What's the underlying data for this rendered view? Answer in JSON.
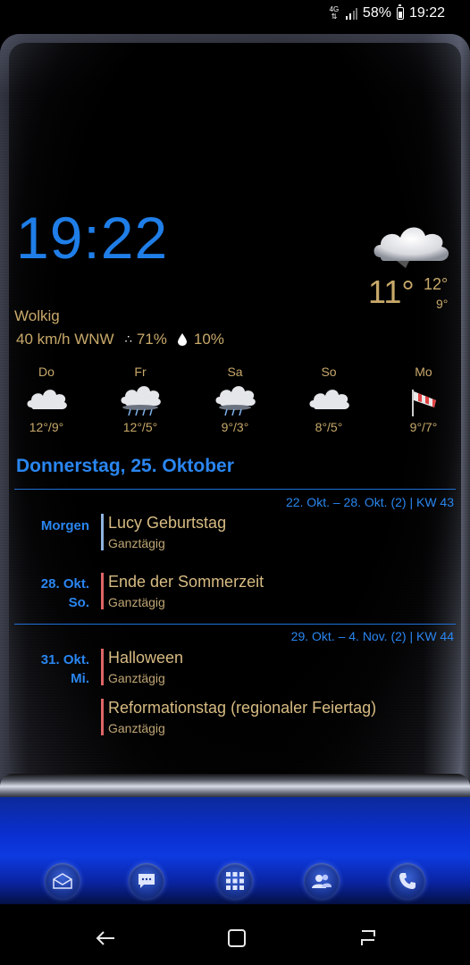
{
  "status_bar": {
    "network": "4G",
    "battery": "58%",
    "time": "19:22"
  },
  "clock": {
    "time": "19:22"
  },
  "weather": {
    "condition": "Wolkig",
    "temperature": "11°",
    "high": "12°",
    "low": "9°",
    "wind": "40 km/h WNW",
    "humidity": "71%",
    "precipitation": "10%",
    "icon": "cloud-icon"
  },
  "forecast": [
    {
      "day": "Do",
      "temp": "12°/9°",
      "icon": "cloud-icon"
    },
    {
      "day": "Fr",
      "temp": "12°/5°",
      "icon": "rain-cloud-icon"
    },
    {
      "day": "Sa",
      "temp": "9°/3°",
      "icon": "rain-cloud-icon"
    },
    {
      "day": "So",
      "temp": "8°/5°",
      "icon": "cloud-icon"
    },
    {
      "day": "Mo",
      "temp": "9°/7°",
      "icon": "windsock-icon"
    }
  ],
  "calendar": {
    "date_header": "Donnerstag, 25. Oktober",
    "weeks": [
      {
        "label": "22. Okt. – 28. Okt. (2) | KW 43"
      },
      {
        "label": "29. Okt. – 4. Nov. (2) | KW 44"
      }
    ],
    "events": [
      {
        "date_line1": "Morgen",
        "date_line2": "",
        "title": "Lucy Geburtstag",
        "subtitle": "Ganztägig",
        "color": "#8fb4e0"
      },
      {
        "date_line1": "28. Okt.",
        "date_line2": "So.",
        "title": "Ende der Sommerzeit",
        "subtitle": "Ganztägig",
        "color": "#e06666"
      },
      {
        "date_line1": "31. Okt.",
        "date_line2": "Mi.",
        "title": "Halloween",
        "subtitle": "Ganztägig",
        "color": "#e06666"
      },
      {
        "date_line1": "",
        "date_line2": "",
        "title": "Reformationstag (regionaler Feiertag)",
        "subtitle": "Ganztägig",
        "color": "#e06666"
      }
    ]
  },
  "dock": [
    {
      "name": "email-icon"
    },
    {
      "name": "messages-icon"
    },
    {
      "name": "apps-icon"
    },
    {
      "name": "contacts-icon"
    },
    {
      "name": "phone-icon"
    }
  ],
  "navigation": [
    {
      "name": "back-icon"
    },
    {
      "name": "home-icon"
    },
    {
      "name": "recents-icon"
    }
  ],
  "colors": {
    "accent_blue": "#2a86f0",
    "gold": "#c8a96a",
    "event_red": "#e06666",
    "event_blue": "#8fb4e0"
  }
}
